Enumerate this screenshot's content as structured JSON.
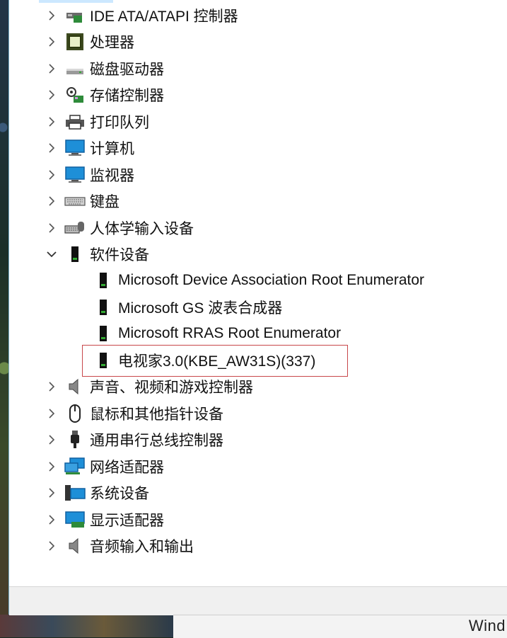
{
  "tree": {
    "categories_before": [
      {
        "label": "IDE ATA/ATAPI 控制器",
        "icon": "ide-controller-icon"
      },
      {
        "label": "处理器",
        "icon": "processor-icon"
      },
      {
        "label": "磁盘驱动器",
        "icon": "disk-drive-icon"
      },
      {
        "label": "存储控制器",
        "icon": "storage-controller-icon"
      },
      {
        "label": "打印队列",
        "icon": "printer-icon"
      },
      {
        "label": "计算机",
        "icon": "computer-icon"
      },
      {
        "label": "监视器",
        "icon": "monitor-icon"
      },
      {
        "label": "键盘",
        "icon": "keyboard-icon"
      },
      {
        "label": "人体学输入设备",
        "icon": "hid-icon"
      }
    ],
    "expanded": {
      "label": "软件设备",
      "icon": "software-device-icon",
      "children": [
        {
          "label": "Microsoft Device Association Root Enumerator"
        },
        {
          "label": "Microsoft GS 波表合成器"
        },
        {
          "label": "Microsoft RRAS Root Enumerator"
        },
        {
          "label": "电视家3.0(KBE_AW31S)(337)"
        }
      ]
    },
    "categories_after": [
      {
        "label": "声音、视频和游戏控制器",
        "icon": "speaker-icon"
      },
      {
        "label": "鼠标和其他指针设备",
        "icon": "mouse-icon"
      },
      {
        "label": "通用串行总线控制器",
        "icon": "usb-icon"
      },
      {
        "label": "网络适配器",
        "icon": "network-adapter-icon"
      },
      {
        "label": "系统设备",
        "icon": "system-device-icon"
      },
      {
        "label": "显示适配器",
        "icon": "display-adapter-icon"
      },
      {
        "label": "音频输入和输出",
        "icon": "audio-io-icon"
      }
    ]
  },
  "background_window": {
    "text": "Wind"
  },
  "colors": {
    "highlight_border": "#c8474a",
    "window_bg": "#ffffff",
    "status_bar_bg": "#f0f0f0"
  }
}
